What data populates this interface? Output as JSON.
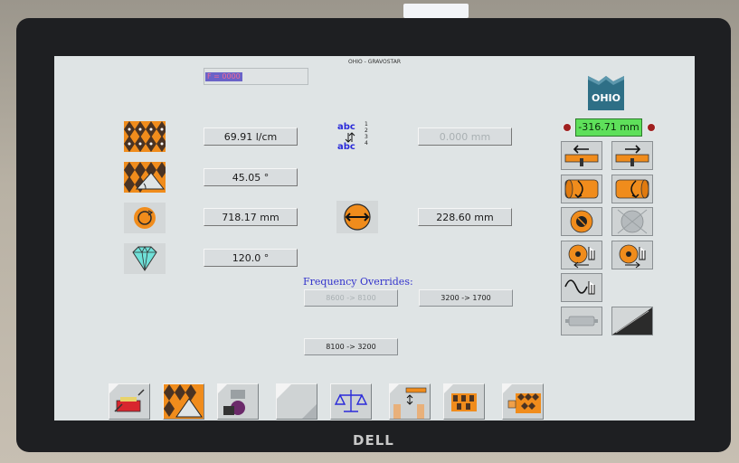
{
  "screen": {
    "title": "OHIO - GRAVOSTAR",
    "f_display": "F = 0000",
    "brand_logo": "OHIO"
  },
  "left_values": [
    {
      "icon": "pattern-icon",
      "value": "69.91 l/cm"
    },
    {
      "icon": "angle-pattern-icon",
      "value": "45.05 °"
    },
    {
      "icon": "cylinder-circumference-icon",
      "value": "718.17 mm"
    },
    {
      "icon": "diamond-icon",
      "value": "120.0 °"
    }
  ],
  "center": {
    "abc_top": "abc",
    "abc_bottom": "abc",
    "abc_numbers": [
      "1",
      "2",
      "3",
      "4"
    ],
    "distance_value": "0.000 mm",
    "width_value": "228.60 mm"
  },
  "frequency": {
    "label": "Frequency Overrides:",
    "button1": "8600 -> 8100",
    "button2": "3200 -> 1700",
    "button3": "8100 -> 3200"
  },
  "right_panel": {
    "readout": "-316.71 mm",
    "buttons": [
      "move-left-icon",
      "move-right-icon",
      "rotate-cylinder-left-icon",
      "rotate-cylinder-right-icon",
      "stop-cylinder-icon",
      "cylinder-grey-icon",
      "cylinder-hand-left-icon",
      "cylinder-hand-right-icon",
      "wave-hand-icon",
      "stylus-grey-icon",
      "scale-0-100-icon"
    ]
  },
  "bottom_toolbar": [
    "tool-kit-icon",
    "pattern-angle-icon",
    "stylus-ink-icon",
    "blank-icon",
    "balance-icon",
    "manual-hand-icon",
    "cells-pattern-icon",
    "cylinder-pattern-icon"
  ],
  "monitor": {
    "brand": "DELL"
  },
  "colors": {
    "screen_bg": "#dfe4e5",
    "accent_orange": "#f08c1c",
    "readout_green": "#5ee05a",
    "freq_blue": "#3333cc"
  }
}
